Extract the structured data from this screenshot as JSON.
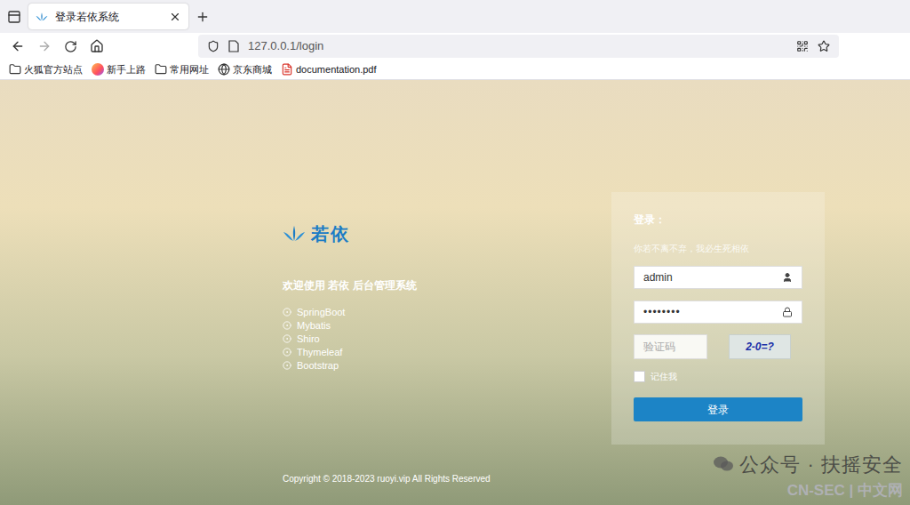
{
  "browser": {
    "tab": {
      "title": "登录若依系统",
      "selected": true
    },
    "url": "127.0.0.1/login",
    "bookmarks": [
      {
        "label": "火狐官方站点",
        "kind": "folder"
      },
      {
        "label": "新手上路",
        "kind": "firefox"
      },
      {
        "label": "常用网址",
        "kind": "folder"
      },
      {
        "label": "京东商城",
        "kind": "globe"
      },
      {
        "label": "documentation.pdf",
        "kind": "pdf"
      }
    ]
  },
  "page": {
    "logo": "若依",
    "welcome": "欢迎使用 若依 后台管理系统",
    "features": [
      "SpringBoot",
      "Mybatis",
      "Shiro",
      "Thymeleaf",
      "Bootstrap"
    ],
    "login": {
      "heading": "登录：",
      "subtitle": "你若不离不弃，我必生死相依",
      "username": "admin",
      "password": "••••••••",
      "captcha_placeholder": "验证码",
      "captcha": "2-0=?",
      "remember": {
        "label": "记住我",
        "checked": false
      },
      "button": "登录"
    },
    "copyright": "Copyright © 2018-2023 ruoyi.vip All Rights Reserved"
  },
  "watermark": {
    "text": "公众号 · 扶摇安全",
    "source": "CN-SEC | 中文网"
  }
}
